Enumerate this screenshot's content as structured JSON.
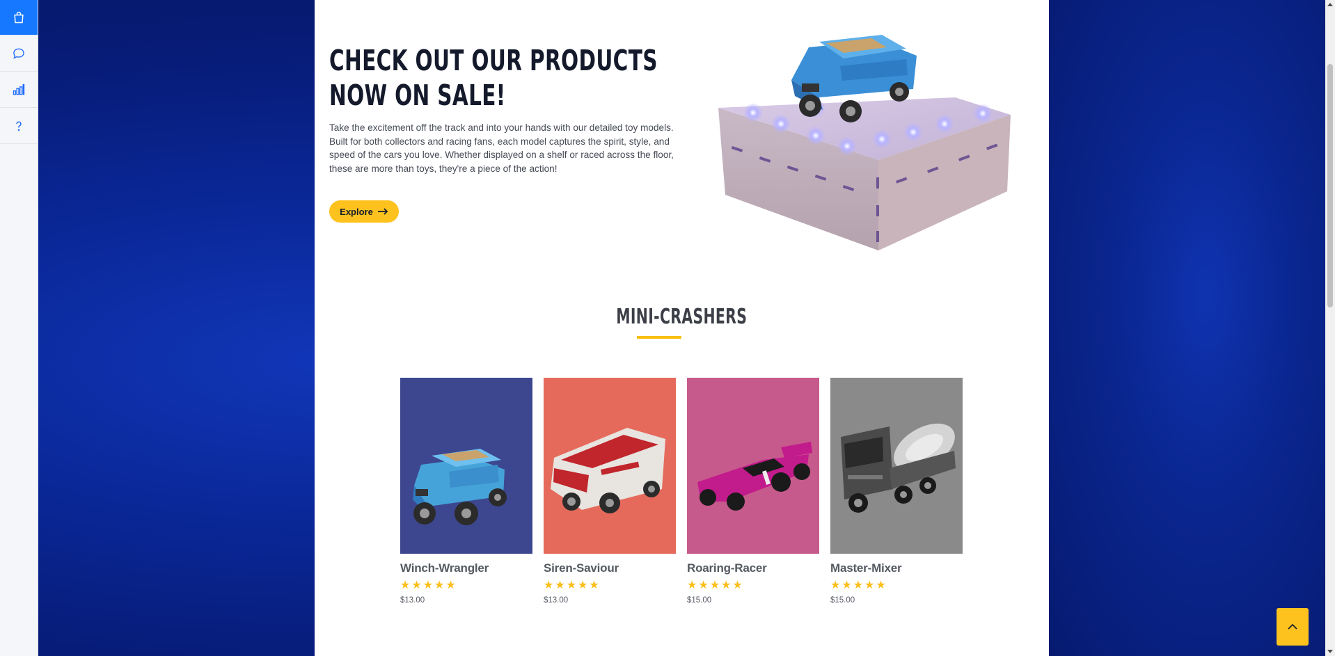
{
  "sidebar": {
    "items": [
      {
        "icon": "shopping-bag-icon",
        "active": true
      },
      {
        "icon": "chat-bubble-icon",
        "active": false
      },
      {
        "icon": "bar-chart-icon",
        "active": false
      },
      {
        "icon": "help-icon",
        "active": false
      }
    ]
  },
  "hero": {
    "title_line1": "CHECK OUT OUR PRODUCTS",
    "title_line2": "NOW ON SALE!",
    "description": "Take the excitement off the track and into your hands with our detailed toy models. Built for both collectors and racing fans, each model captures the spirit, style, and speed of the cars you love. Whether displayed on a shelf or raced across the floor, these are more than toys, they're a piece of the action!",
    "button_label": "Explore",
    "button_icon": "arrow-right-icon"
  },
  "section": {
    "title": "MINI-CRASHERS",
    "accent_color": "#f7c012"
  },
  "products": [
    {
      "name": "Winch-Wrangler",
      "stars": "★★★★★",
      "price": "$13.00",
      "bg": "#3d478f"
    },
    {
      "name": "Siren-Saviour",
      "stars": "★★★★★",
      "price": "$13.00",
      "bg": "#e56a5b"
    },
    {
      "name": "Roaring-Racer",
      "stars": "★★★★★",
      "price": "$15.00",
      "bg": "#c75a8c"
    },
    {
      "name": "Master-Mixer",
      "stars": "★★★★★",
      "price": "$15.00",
      "bg": "#8a8a8a"
    }
  ],
  "back_to_top": {
    "icon": "chevron-up-icon"
  },
  "colors": {
    "brand_blue": "#1677ff",
    "accent_yellow": "#fdc21e"
  }
}
